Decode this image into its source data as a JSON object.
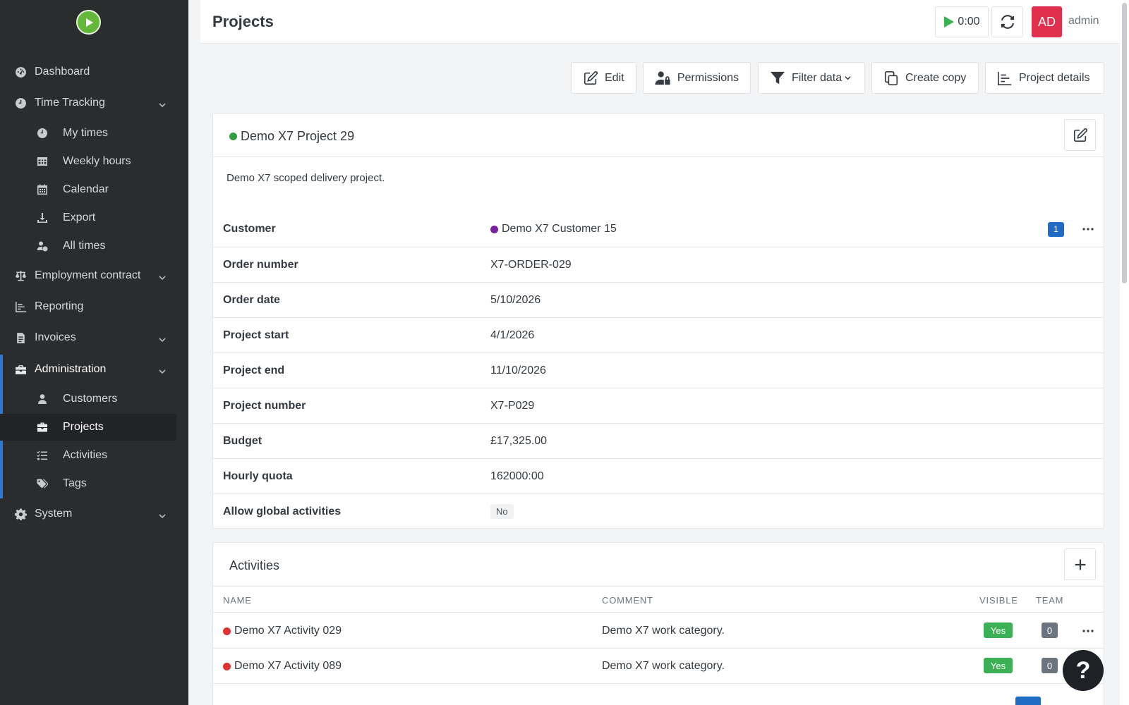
{
  "sidebar": {
    "items": {
      "dashboard": "Dashboard",
      "time_tracking": "Time Tracking",
      "my_times": "My times",
      "weekly_hours": "Weekly hours",
      "calendar": "Calendar",
      "export": "Export",
      "all_times": "All times",
      "employment_contract": "Employment contract",
      "reporting": "Reporting",
      "invoices": "Invoices",
      "administration": "Administration",
      "customers": "Customers",
      "projects": "Projects",
      "activities": "Activities",
      "tags": "Tags",
      "system": "System"
    },
    "active_item": "Projects"
  },
  "header": {
    "title": "Projects",
    "timer": "0:00",
    "avatar_initials": "AD",
    "username": "admin"
  },
  "toolbar": {
    "edit": "Edit",
    "permissions": "Permissions",
    "filter_data": "Filter data",
    "create_copy": "Create copy",
    "project_details": "Project details"
  },
  "project": {
    "name": "Demo X7 Project 29",
    "status_color": "#2f9e44",
    "description": "Demo X7 scoped delivery project.",
    "fields": {
      "customer": {
        "label": "Customer",
        "value": "Demo X7 Customer 15",
        "color": "#7b1fa2",
        "count": "1"
      },
      "order_number": {
        "label": "Order number",
        "value": "X7-ORDER-029"
      },
      "order_date": {
        "label": "Order date",
        "value": "5/10/2026"
      },
      "project_start": {
        "label": "Project start",
        "value": "4/1/2026"
      },
      "project_end": {
        "label": "Project end",
        "value": "11/10/2026"
      },
      "project_number": {
        "label": "Project number",
        "value": "X7-P029"
      },
      "budget": {
        "label": "Budget",
        "value": "£17,325.00"
      },
      "hourly_quota": {
        "label": "Hourly quota",
        "value": "162000:00"
      },
      "allow_global_activities": {
        "label": "Allow global activities",
        "value": "No"
      }
    }
  },
  "activities": {
    "title": "Activities",
    "columns": {
      "name": "NAME",
      "comment": "COMMENT",
      "visible": "VISIBLE",
      "team": "TEAM"
    },
    "rows": [
      {
        "name": "Demo X7 Activity 029",
        "comment": "Demo X7 work category.",
        "visible": "Yes",
        "team": "0",
        "color": "#e03131"
      },
      {
        "name": "Demo X7 Activity 089",
        "comment": "Demo X7 work category.",
        "visible": "Yes",
        "team": "0",
        "color": "#e03131"
      }
    ]
  },
  "help": {
    "symbol": "?"
  },
  "colors": {
    "sidebar": "#2b2c2e",
    "accent": "#206bc4",
    "avatar": "#e0304d",
    "success": "#3cb054"
  }
}
